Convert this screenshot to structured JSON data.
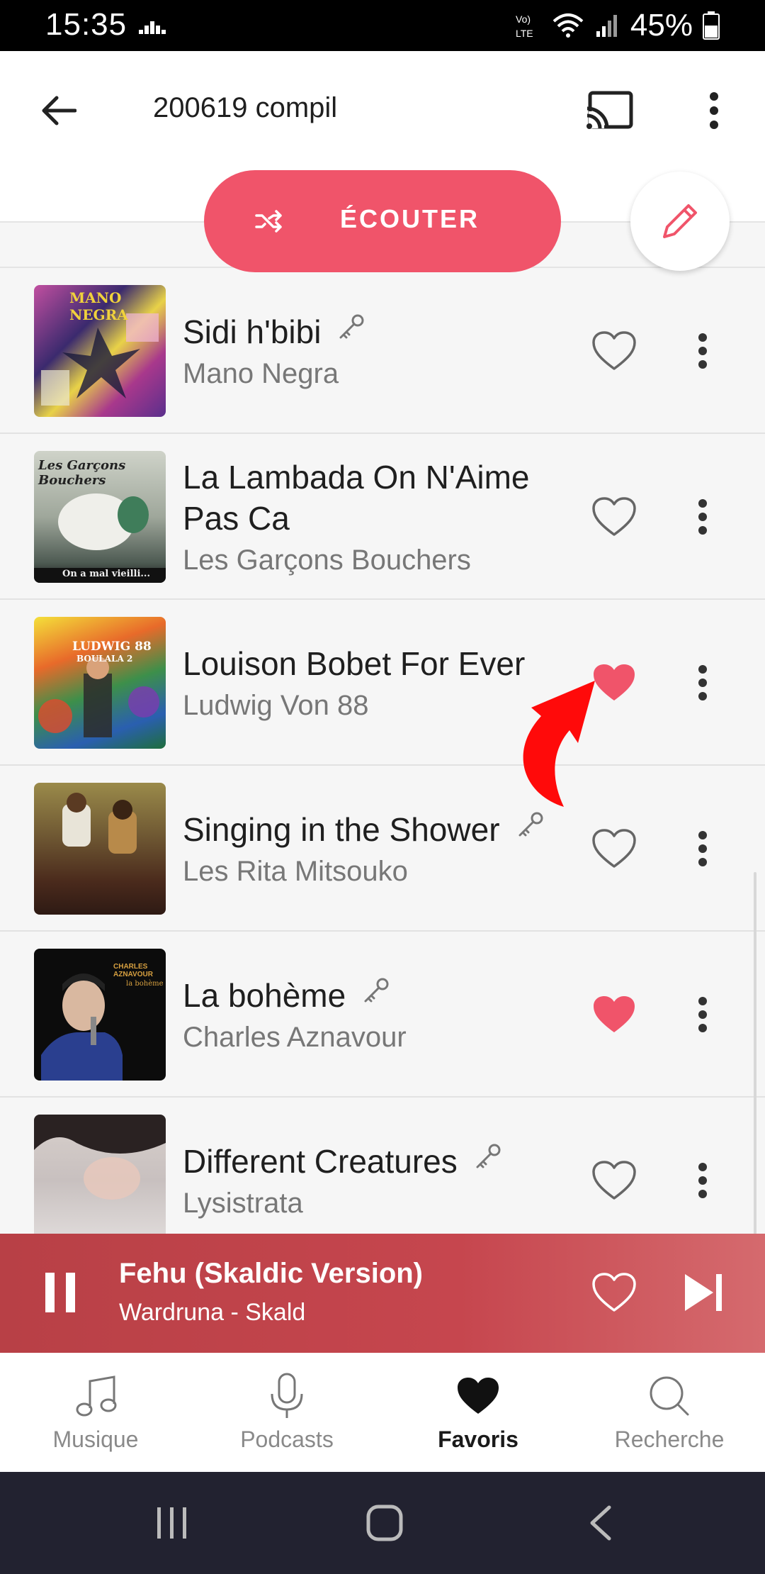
{
  "status_bar": {
    "time": "15:35",
    "battery_text": "45%",
    "icons": [
      "sound-equalizer-icon",
      "volte-icon",
      "wifi-icon",
      "signal-icon",
      "battery-icon"
    ]
  },
  "header": {
    "title": "200619 compil",
    "icons": [
      "back-arrow-icon",
      "cast-icon",
      "more-vertical-icon"
    ]
  },
  "actions": {
    "listen_label": "ÉCOUTER",
    "shuffle_icon": "shuffle-icon",
    "edit_icon": "pencil-icon"
  },
  "tracks": [
    {
      "title": "Sidi h'bibi",
      "artist": "Mano Negra",
      "has_key": true,
      "favorite": false,
      "cover_text": "MANO NEGRA"
    },
    {
      "title": "La Lambada On N'Aime Pas Ca",
      "artist": "Les Garçons Bouchers",
      "has_key": false,
      "favorite": false,
      "cover_text": "Les Garçons Bouchers",
      "cover_sub": "On a mal vieilli..."
    },
    {
      "title": "Louison Bobet For Ever",
      "artist": "Ludwig Von 88",
      "has_key": false,
      "favorite": true,
      "cover_text": "LUDWIG 88",
      "cover_sub": "BOULALA 2"
    },
    {
      "title": "Singing in the Shower",
      "artist": "Les Rita Mitsouko",
      "has_key": true,
      "favorite": false
    },
    {
      "title": "La bohème",
      "artist": "Charles Aznavour",
      "has_key": true,
      "favorite": true,
      "cover_text": "CHARLES AZNAVOUR",
      "cover_sub": "la bohème"
    },
    {
      "title": "Different Creatures",
      "artist": "Lysistrata",
      "has_key": true,
      "favorite": false
    }
  ],
  "mini_player": {
    "title": "Fehu (Skaldic Version)",
    "subtitle": "Wardruna - Skald",
    "favorite": false
  },
  "bottom_nav": [
    {
      "label": "Musique",
      "icon": "music-note-icon",
      "active": false
    },
    {
      "label": "Podcasts",
      "icon": "microphone-icon",
      "active": false
    },
    {
      "label": "Favoris",
      "icon": "heart-icon",
      "active": true
    },
    {
      "label": "Recherche",
      "icon": "search-icon",
      "active": false
    }
  ],
  "colors": {
    "accent": "#f0546a",
    "player_bg": "#c6464e",
    "annotation_arrow": "#ff0000"
  }
}
